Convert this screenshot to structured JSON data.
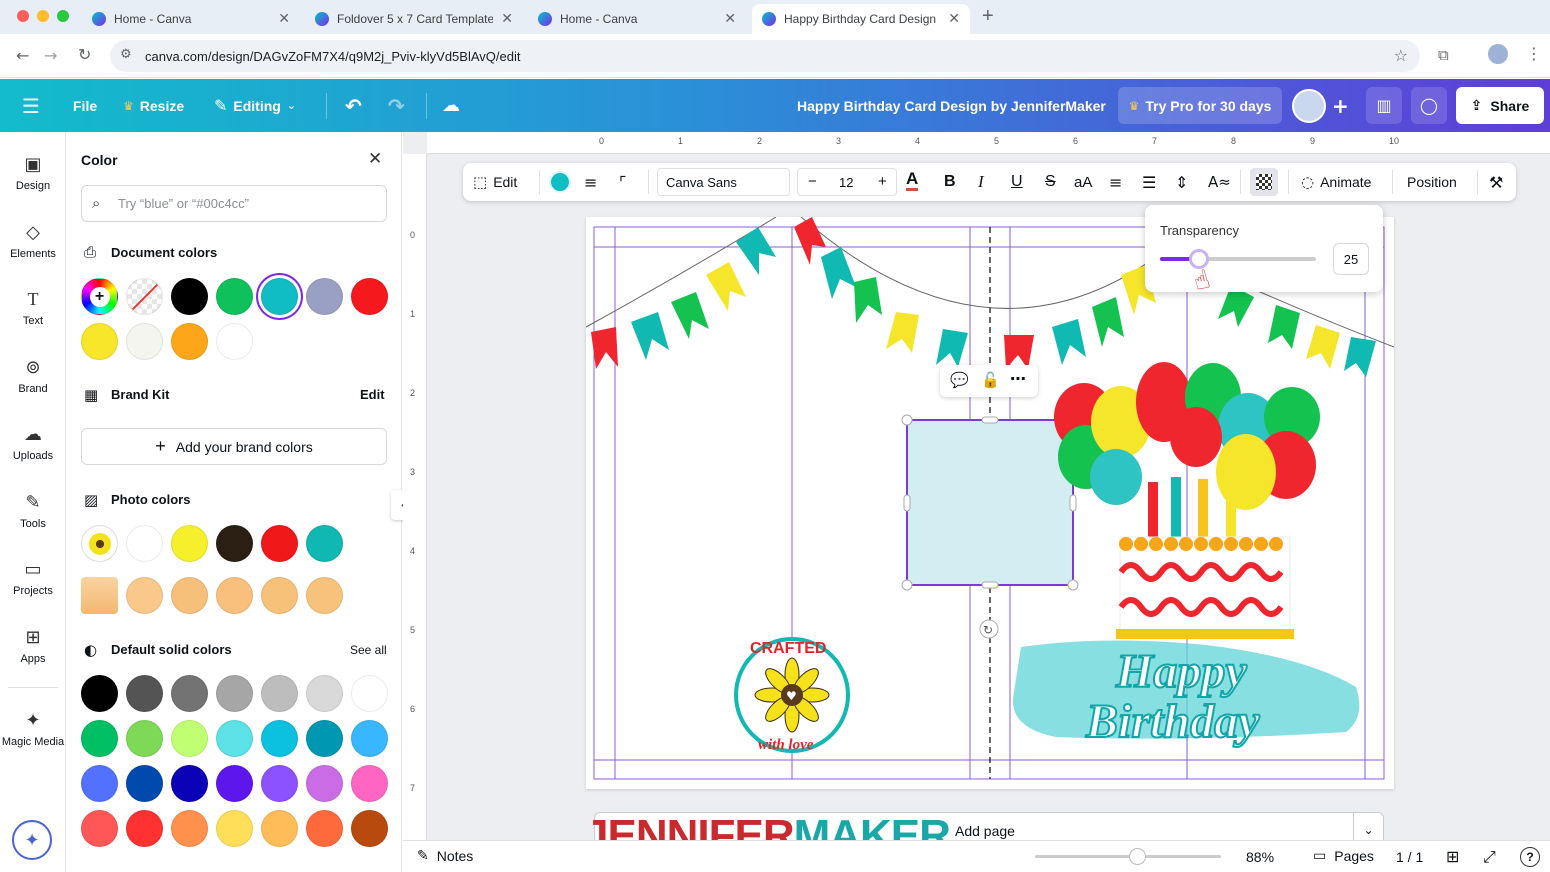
{
  "browser": {
    "tabs": [
      {
        "title": "Home - Canva",
        "active": false
      },
      {
        "title": "Foldover 5 x 7 Card Template",
        "active": false
      },
      {
        "title": "Home - Canva",
        "active": false
      },
      {
        "title": "Happy Birthday Card Design",
        "active": true
      }
    ],
    "new_tab": "+",
    "url": "canva.com/design/DAGvZoFM7X4/q9M2j_Pviv-klyVd5BlAvQ/edit"
  },
  "header": {
    "file": "File",
    "resize": "Resize",
    "editing": "Editing",
    "doc_title": "Happy Birthday Card Design by JenniferMaker",
    "try_pro": "Try Pro for 30 days",
    "share": "Share"
  },
  "rail": [
    {
      "label": "Design",
      "icon": "design-icon"
    },
    {
      "label": "Elements",
      "icon": "elements-icon"
    },
    {
      "label": "Text",
      "icon": "text-icon"
    },
    {
      "label": "Brand",
      "icon": "brand-icon"
    },
    {
      "label": "Uploads",
      "icon": "uploads-icon"
    },
    {
      "label": "Tools",
      "icon": "tools-icon"
    },
    {
      "label": "Projects",
      "icon": "projects-icon"
    },
    {
      "label": "Apps",
      "icon": "apps-icon"
    },
    {
      "label": "Magic Media",
      "icon": "magic-media-icon"
    }
  ],
  "panel": {
    "title": "Color",
    "search_placeholder": "Try “blue” or “#00c4cc”",
    "document_colors_title": "Document colors",
    "document_colors": [
      "#000000",
      "#0fc15b",
      "#9aa0c4",
      "#f5181c",
      "#f8e62a",
      "#f5f5f0",
      "#fda619",
      "#ffffff"
    ],
    "brand_kit_title": "Brand Kit",
    "brand_kit_edit": "Edit",
    "add_brand_colors": "Add your brand colors",
    "photo_colors_title": "Photo colors",
    "photo_colors": [
      "#ffffff",
      "#f6f02c",
      "#2b1f14",
      "#f01818",
      "#10b8b4",
      "#f9c88a",
      "#f7c07a",
      "#f8c07c",
      "#f8c17a",
      "#f7c37c"
    ],
    "default_colors_title": "Default solid colors",
    "see_all": "See all",
    "default_colors": [
      "#000000",
      "#545454",
      "#737373",
      "#a6a6a6",
      "#bdbdbd",
      "#d9d9d9",
      "#ffffff",
      "#00bf63",
      "#7ed957",
      "#c1ff72",
      "#5ce1e6",
      "#0cc0df",
      "#0097b2",
      "#38b6ff",
      "#5271ff",
      "#004aad",
      "#0a00b6",
      "#5e17eb",
      "#8c52ff",
      "#cb6ce6",
      "#ff66c4",
      "#ff5757",
      "#ff3131",
      "#ff914d",
      "#ffde59",
      "#ffbd59",
      "#ff6a3d",
      "#b84a0e"
    ]
  },
  "ctx_toolbar": {
    "edit": "Edit",
    "font": "Canva Sans",
    "minus": "−",
    "font_size": "12",
    "plus": "+",
    "bold": "B",
    "italic": "I",
    "underline": "U",
    "strike": "S",
    "case": "aA",
    "animate": "Animate",
    "position": "Position",
    "selected_color": "#10bdc4"
  },
  "transparency": {
    "label": "Transparency",
    "value": "25",
    "fraction": 0.25
  },
  "ruler": {
    "top": [
      "0",
      "1",
      "2",
      "3",
      "4",
      "5",
      "6",
      "7",
      "8",
      "9",
      "10"
    ],
    "left": [
      "0",
      "1",
      "2",
      "3",
      "4",
      "5",
      "6",
      "7"
    ]
  },
  "card": {
    "logo_top": "CRAFTED",
    "logo_bottom": "with love",
    "happy": "Happy",
    "birthday": "Birthday"
  },
  "watermark": {
    "jennifer": "JENNIFER",
    "maker": "MAKER"
  },
  "add_page": "Add page",
  "bottom": {
    "notes": "Notes",
    "zoom": "88%",
    "pages": "Pages",
    "page_count": "1 / 1",
    "help": "?"
  }
}
